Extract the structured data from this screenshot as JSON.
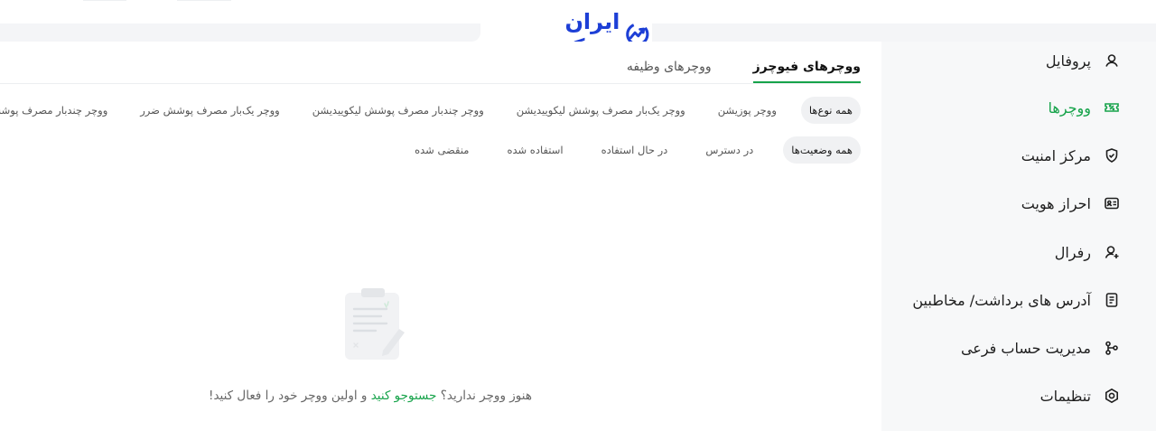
{
  "brand": {
    "name": "ایران بروکر",
    "color": "#1d3fd6"
  },
  "accent_color": "#16a34a",
  "sidebar": {
    "items": [
      {
        "label": "پروفایل",
        "icon": "user-icon",
        "active": false
      },
      {
        "label": "ووچرها",
        "icon": "ticket-icon",
        "active": true
      },
      {
        "label": "مرکز امنیت",
        "icon": "shield-icon",
        "active": false
      },
      {
        "label": "احراز هویت",
        "icon": "id-card-icon",
        "active": false
      },
      {
        "label": "رفرال",
        "icon": "user-plus-icon",
        "active": false
      },
      {
        "label": "آدرس های برداشت/ مخاطبین",
        "icon": "address-book-icon",
        "active": false
      },
      {
        "label": "مدیریت حساب فرعی",
        "icon": "sub-account-icon",
        "active": false
      },
      {
        "label": "تنظیمات",
        "icon": "settings-icon",
        "active": false
      }
    ]
  },
  "tabs": [
    {
      "label": "ووچرهای فیوچرز",
      "active": true
    },
    {
      "label": "ووچرهای وظیفه",
      "active": false
    }
  ],
  "type_filters": [
    {
      "label": "همه نوع‌ها",
      "active": true
    },
    {
      "label": "ووچر پوزیشن",
      "active": false
    },
    {
      "label": "ووچر یک‌بار مصرف پوشش لیکوییدیشن",
      "active": false
    },
    {
      "label": "ووچر چندبار مصرف پوشش لیکوییدیشن",
      "active": false
    },
    {
      "label": "ووچر یک‌بار مصرف پوشش ضرر",
      "active": false
    },
    {
      "label": "ووچر چندبار مصرف پوشش ضرر",
      "active": false
    }
  ],
  "status_filters": [
    {
      "label": "همه وضعیت‌ها",
      "active": true
    },
    {
      "label": "در دسترس",
      "active": false
    },
    {
      "label": "در حال استفاده",
      "active": false
    },
    {
      "label": "استفاده شده",
      "active": false
    },
    {
      "label": "منقضی شده",
      "active": false
    }
  ],
  "empty_state": {
    "text_before": "هنوز ووچر ندارید؟ ",
    "link_text": "جستوجو کنید",
    "text_after": " و اولین ووچر خود را فعال کنید!",
    "icon": "clipboard-empty-icon"
  }
}
